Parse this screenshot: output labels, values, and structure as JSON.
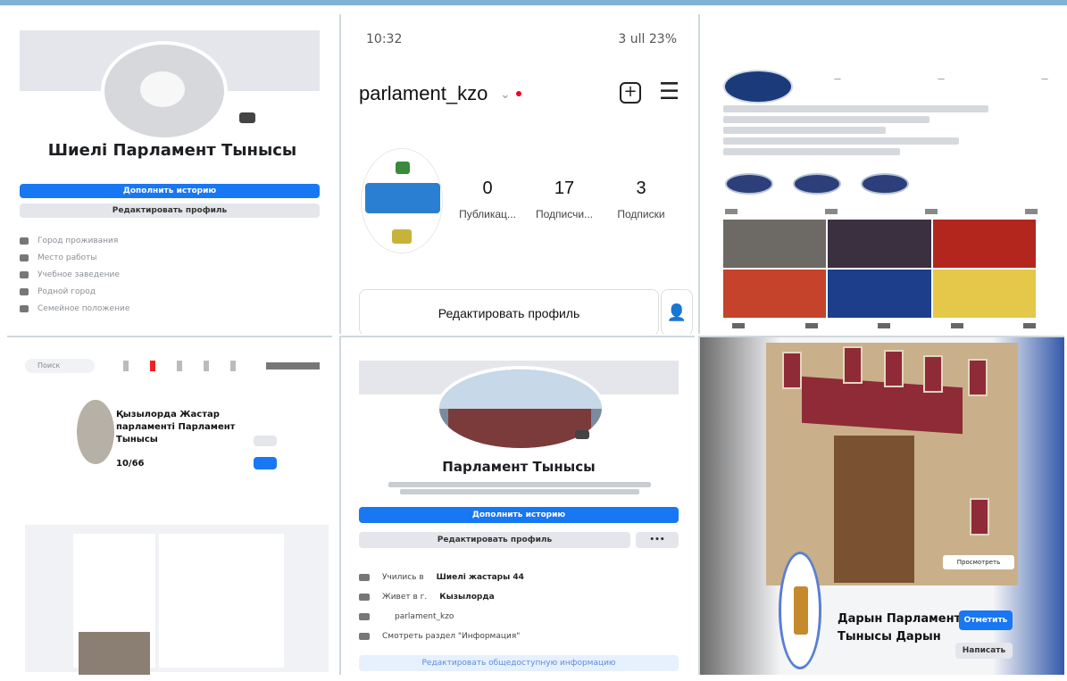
{
  "panel1": {
    "page_name": "Шиелі Парламент Тынысы",
    "primary_button": "Дополнить историю",
    "edit_button": "Редактировать профиль",
    "info_rows": [
      "Город проживания",
      "Место работы",
      "Учебное заведение",
      "Родной город",
      "Семейное положение"
    ]
  },
  "panel2": {
    "time": "10:32",
    "status_right": "3 ull 23%",
    "handle": "parlament_kzo",
    "stats": [
      {
        "value": "0",
        "label": "Публикац..."
      },
      {
        "value": "17",
        "label": "Подписчи..."
      },
      {
        "value": "3",
        "label": "Подписки"
      }
    ],
    "edit_button": "Редактировать профиль"
  },
  "panel4": {
    "search_placeholder": "Поиск",
    "page_title": "Қызылорда Жастар парламенті Парламент Тынысы",
    "likes": "10/66"
  },
  "panel5": {
    "page_name": "Парламент Тынысы",
    "primary_button": "Дополнить историю",
    "edit_button": "Редактировать профиль",
    "more_button": "•••",
    "info_rows": [
      {
        "pre": "Учились в",
        "bold": "Шиелі жастары 44"
      },
      {
        "pre": "Живет в г.",
        "bold": "Кызылорда"
      },
      {
        "pre": "",
        "bold": "parlament_kzo"
      },
      {
        "pre": "Смотреть раздел \"Информация\"",
        "bold": ""
      }
    ],
    "bottom_button": "Редактировать общедоступную информацию"
  },
  "panel6": {
    "label": "Просмотреть",
    "page_name": "Дарын Парламент Тынысы Дарын",
    "btn_primary": "Отметить",
    "btn_secondary": "Написать"
  }
}
